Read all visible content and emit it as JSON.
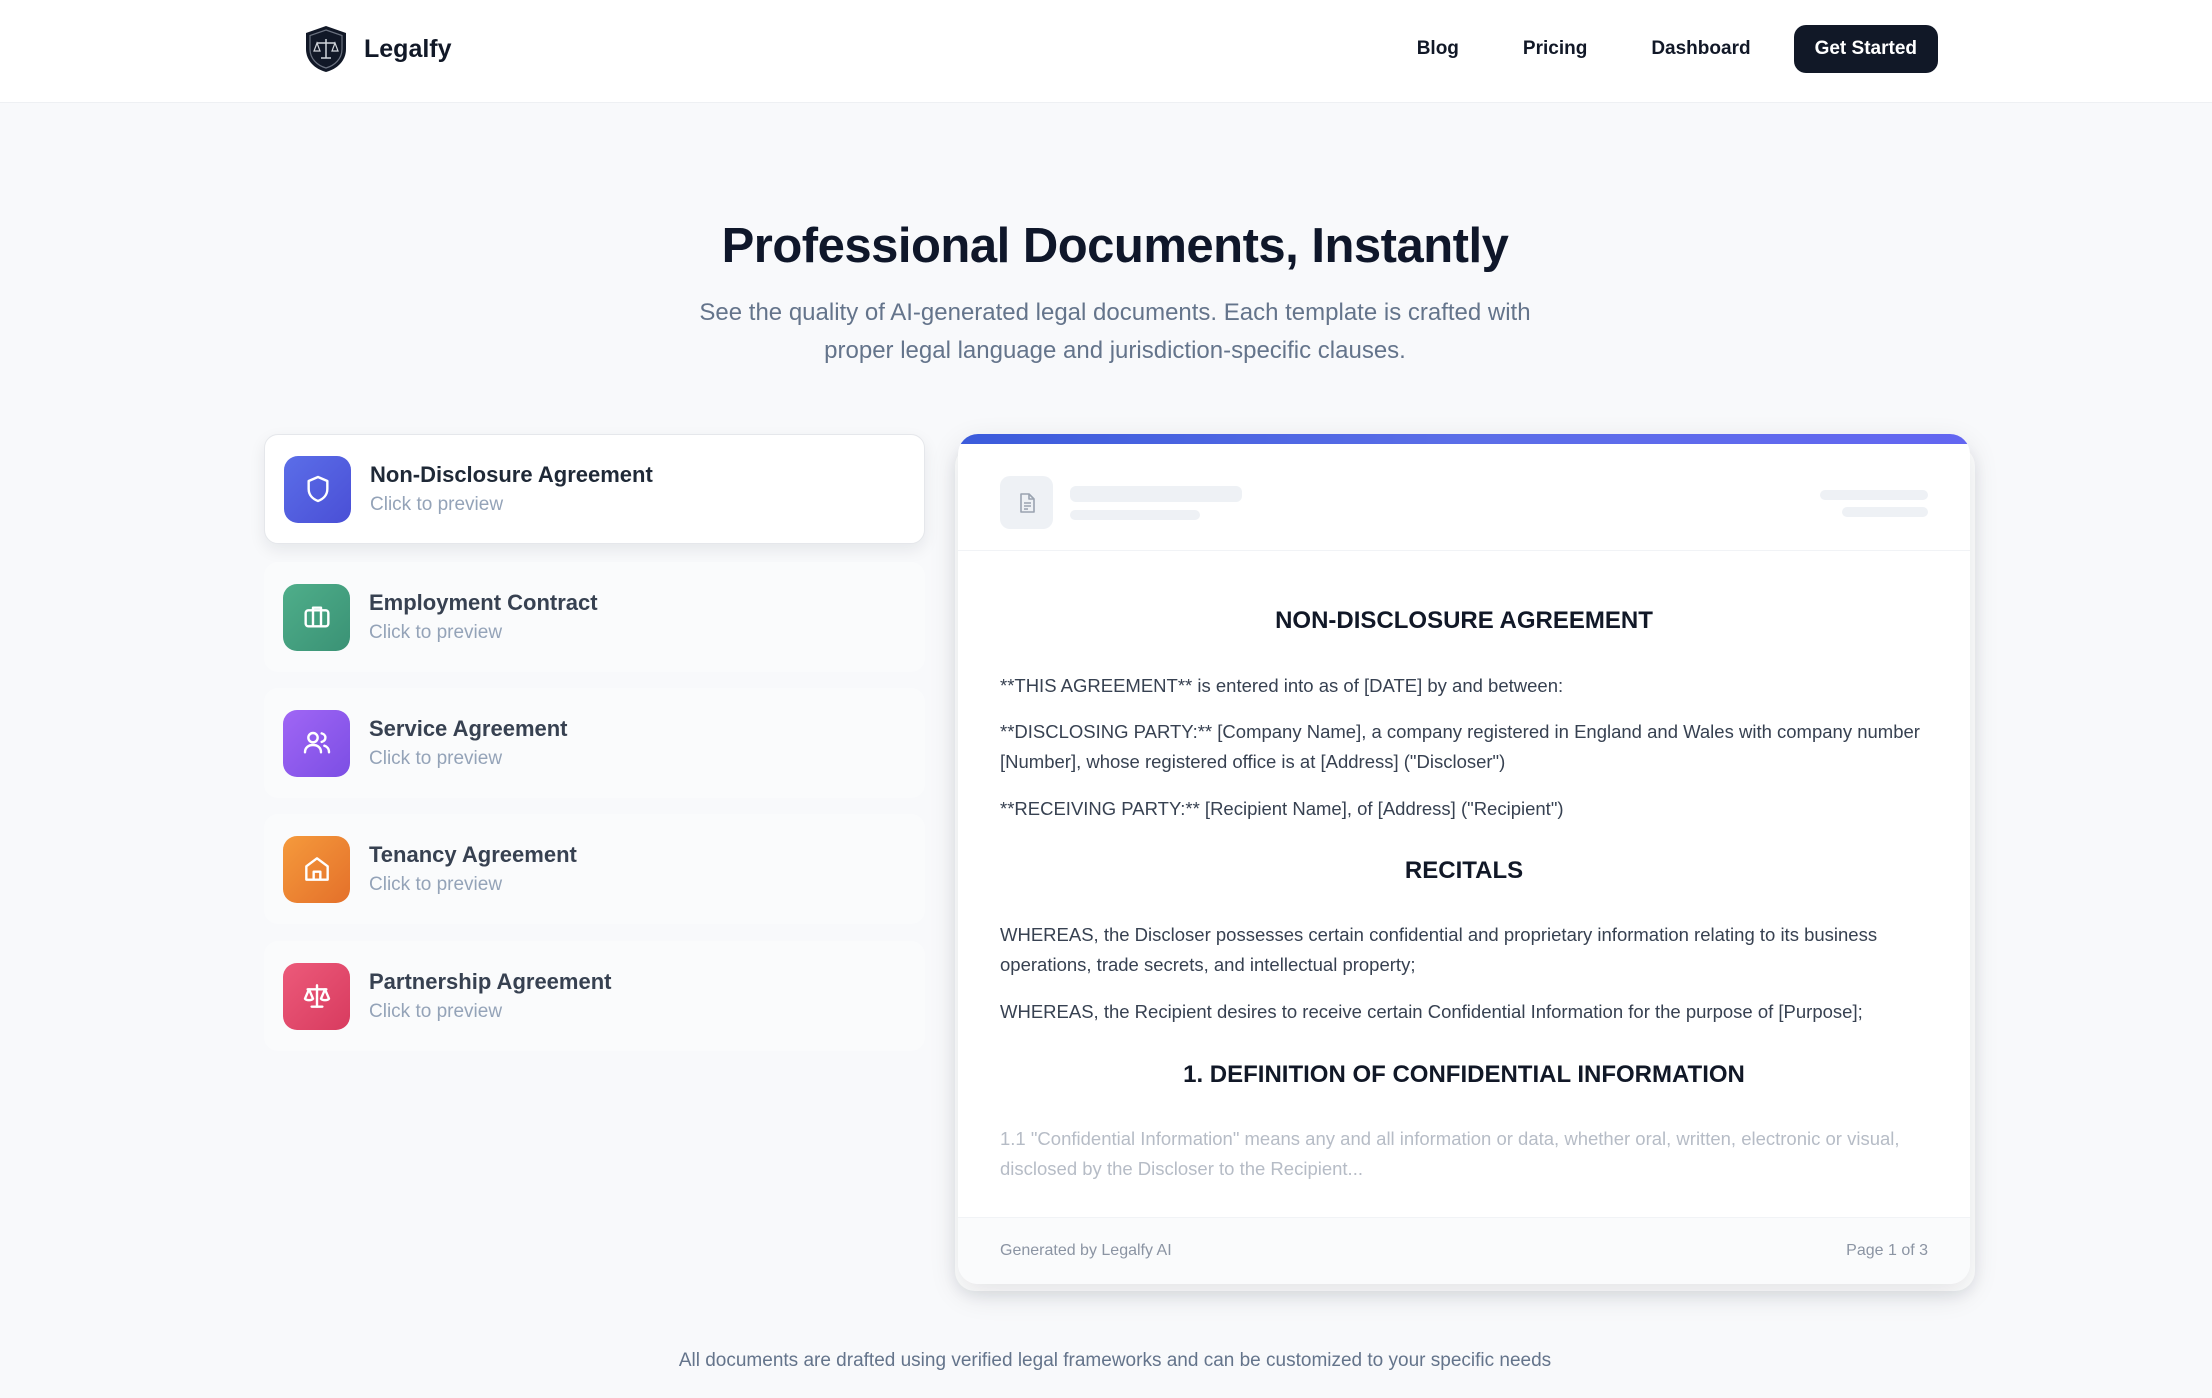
{
  "header": {
    "brand": "Legalfy",
    "nav": [
      "Blog",
      "Pricing",
      "Dashboard"
    ],
    "cta": "Get Started"
  },
  "hero": {
    "title": "Professional Documents, Instantly",
    "subtitle": "See the quality of AI-generated legal documents. Each template is crafted with proper legal language and jurisdiction-specific clauses."
  },
  "templates": [
    {
      "title": "Non-Disclosure Agreement",
      "sub": "Click to preview",
      "icon": "shield-icon",
      "color": "#4f5fe0",
      "active": true
    },
    {
      "title": "Employment Contract",
      "sub": "Click to preview",
      "icon": "briefcase-icon",
      "color": "#3e9e7e",
      "active": false
    },
    {
      "title": "Service Agreement",
      "sub": "Click to preview",
      "icon": "users-icon",
      "color": "#8b5cf6",
      "active": false
    },
    {
      "title": "Tenancy Agreement",
      "sub": "Click to preview",
      "icon": "home-icon",
      "color": "#f07a2b",
      "active": false
    },
    {
      "title": "Partnership Agreement",
      "sub": "Click to preview",
      "icon": "scale-icon",
      "color": "#e0426a",
      "active": false
    }
  ],
  "preview": {
    "heading": "NON-DISCLOSURE AGREEMENT",
    "p1": "**THIS AGREEMENT** is entered into as of [DATE] by and between:",
    "p2": "**DISCLOSING PARTY:** [Company Name], a company registered in England and Wales with company number [Number], whose registered office is at [Address] (\"Discloser\")",
    "p3": "**RECEIVING PARTY:** [Recipient Name], of [Address] (\"Recipient\")",
    "recitals": "RECITALS",
    "p4": "WHEREAS, the Discloser possesses certain confidential and proprietary information relating to its business operations, trade secrets, and intellectual property;",
    "p5": "WHEREAS, the Recipient desires to receive certain Confidential Information for the purpose of [Purpose];",
    "section1": "1. DEFINITION OF CONFIDENTIAL INFORMATION",
    "p6": "1.1 \"Confidential Information\" means any and all information or data, whether oral, written, electronic or visual, disclosed by the Discloser to the Recipient...",
    "footer_left": "Generated by Legalfy AI",
    "footer_right": "Page 1 of 3"
  },
  "footnote": "All documents are drafted using verified legal frameworks and can be customized to your specific needs"
}
